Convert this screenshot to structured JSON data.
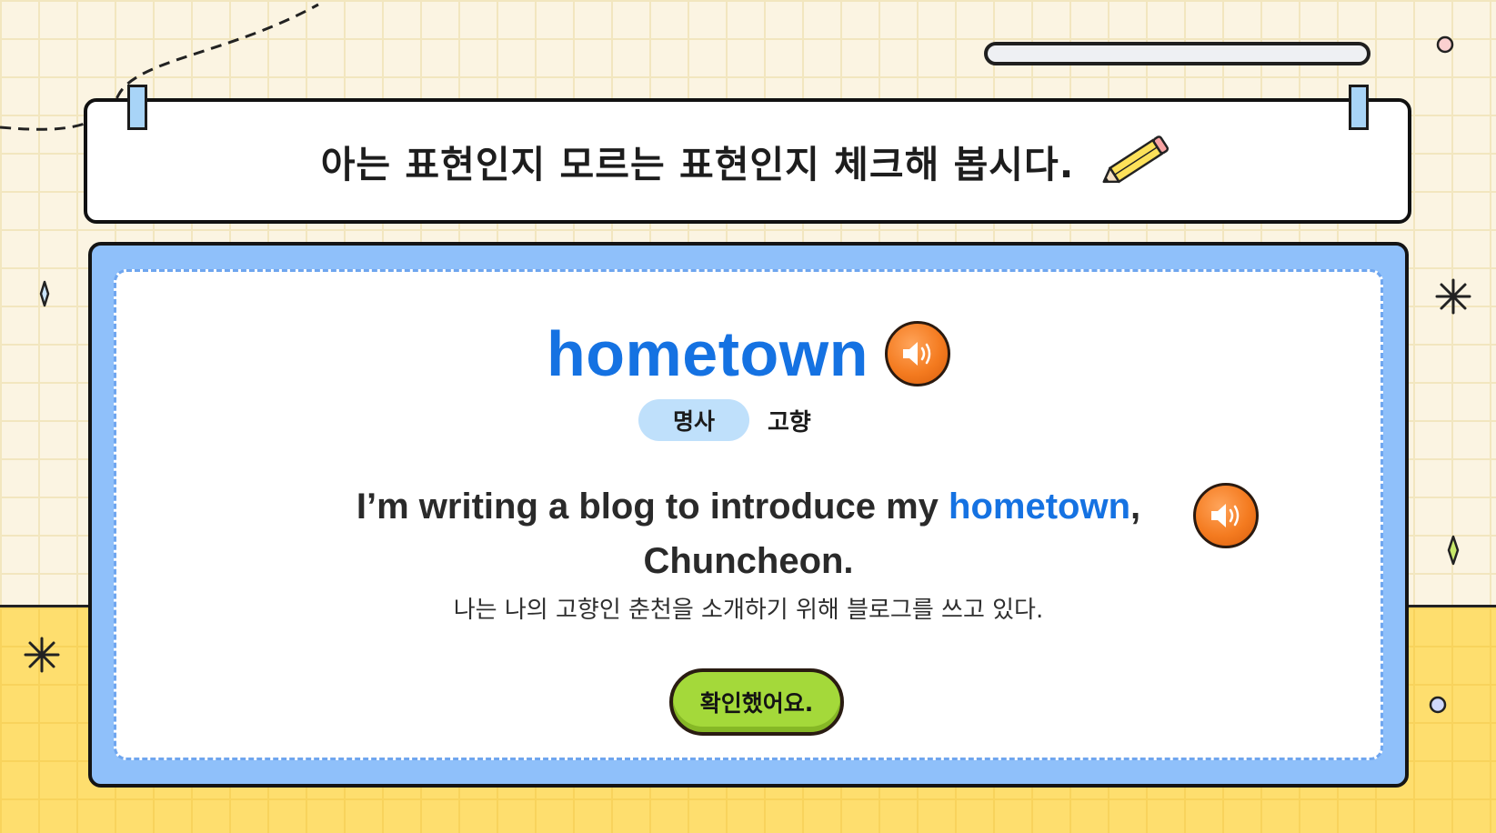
{
  "header": {
    "instruction": "아는 표현인지 모르는 표현인지 체크해 봅시다."
  },
  "progress": {
    "value": 0
  },
  "word_card": {
    "word": "hometown",
    "part_of_speech": "명사",
    "meaning": "고향",
    "sentence": {
      "before": "I’m writing a blog to introduce my ",
      "highlight": "hometown",
      "after": ",",
      "line2": "Chuncheon."
    },
    "translation": "나는 나의 고향인 춘천을 소개하기 위해 블로그를 쓰고 있다.",
    "confirm_label": "확인했어요."
  },
  "icons": {
    "speaker": "speaker-icon",
    "pencil": "pencil-icon"
  },
  "colors": {
    "accent_blue": "#1572e2",
    "card_blue": "#8fc0fa",
    "badge_blue": "#bfe0fb",
    "speaker_orange": "#f47b20",
    "confirm_green": "#a4d93a",
    "band_yellow": "#fede6e"
  }
}
